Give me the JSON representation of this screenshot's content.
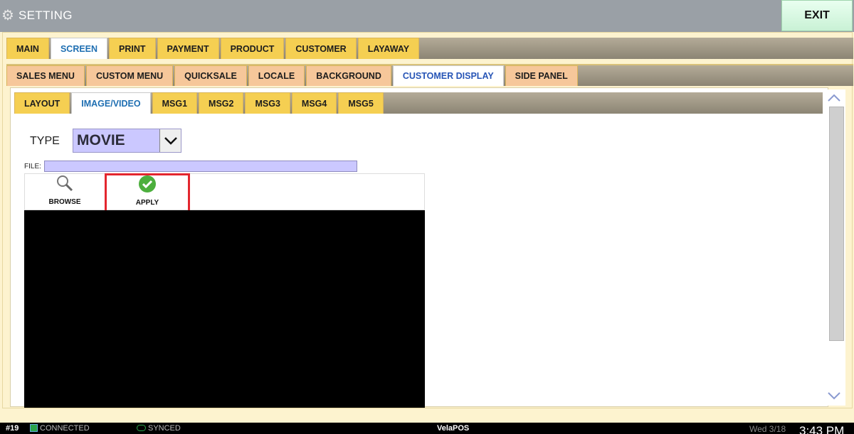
{
  "window": {
    "title": "SETTING",
    "exit_label": "EXIT"
  },
  "tabs_main": [
    "MAIN",
    "SCREEN",
    "PRINT",
    "PAYMENT",
    "PRODUCT",
    "CUSTOMER",
    "LAYAWAY"
  ],
  "tabs_screen": [
    "SALES MENU",
    "CUSTOM MENU",
    "QUICKSALE",
    "LOCALE",
    "BACKGROUND",
    "CUSTOMER DISPLAY",
    "SIDE PANEL"
  ],
  "tabs_display": [
    "LAYOUT",
    "IMAGE/VIDEO",
    "MSG1",
    "MSG2",
    "MSG3",
    "MSG4",
    "MSG5"
  ],
  "active": {
    "main": "SCREEN",
    "screen": "CUSTOMER DISPLAY",
    "display": "IMAGE/VIDEO"
  },
  "form": {
    "type_label": "TYPE",
    "type_value": "MOVIE",
    "file_label": "FILE:",
    "file_value": ""
  },
  "buttons": {
    "browse": "BROWSE",
    "apply": "APPLY"
  },
  "status": {
    "station": "#19",
    "connection": "CONNECTED",
    "sync": "SYNCED",
    "brand": "VelaPOS",
    "date": "Wed 3/18",
    "time": "3:43 PM"
  },
  "colors": {
    "tab_yellow": "#f5cf52",
    "tab_orange": "#f6c79a",
    "field_purple": "#cbc8ff",
    "highlight_red": "#e3262e"
  }
}
